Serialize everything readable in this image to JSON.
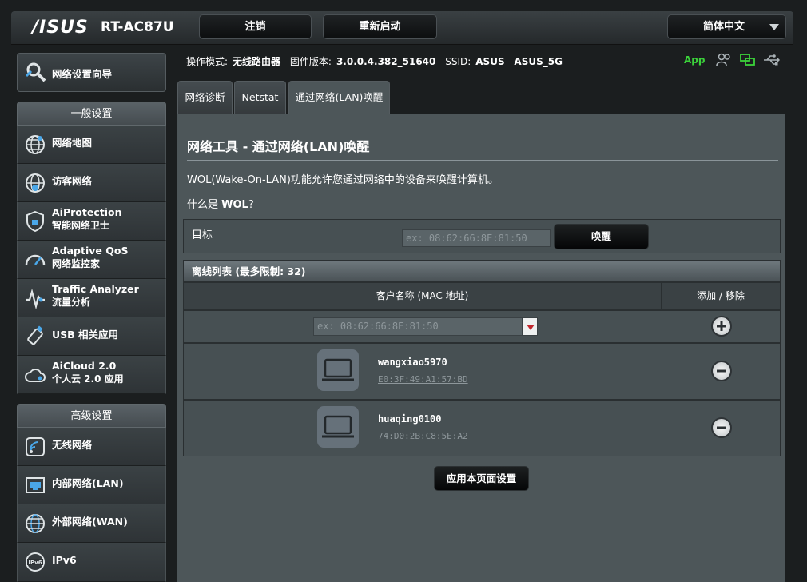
{
  "header": {
    "logo": "/ISUS",
    "model": "RT-AC87U",
    "logout_label": "注销",
    "reboot_label": "重新启动",
    "language": "简体中文"
  },
  "sidebar": {
    "wizard_label": "网络设置向导",
    "general_heading": "一般设置",
    "general_items": [
      {
        "label": "网络地图",
        "sub": ""
      },
      {
        "label": "访客网络",
        "sub": ""
      },
      {
        "label": "AiProtection",
        "sub": "智能网络卫士"
      },
      {
        "label": "Adaptive QoS",
        "sub": "网络监控家"
      },
      {
        "label": "Traffic Analyzer",
        "sub": "流量分析"
      },
      {
        "label": "USB 相关应用",
        "sub": ""
      },
      {
        "label": "AiCloud 2.0",
        "sub": "个人云 2.0 应用"
      }
    ],
    "advanced_heading": "高级设置",
    "advanced_items": [
      {
        "label": "无线网络"
      },
      {
        "label": "内部网络(LAN)"
      },
      {
        "label": "外部网络(WAN)"
      },
      {
        "label": "IPv6"
      }
    ]
  },
  "status": {
    "mode_label": "操作模式:",
    "mode_value": "无线路由器",
    "fw_label": "固件版本:",
    "fw_value": "3.0.0.4.382_51640",
    "ssid_label": "SSID:",
    "ssid1": "ASUS",
    "ssid2": "ASUS_5G",
    "app_label": "App"
  },
  "tabs": [
    {
      "label": "网络诊断"
    },
    {
      "label": "Netstat"
    },
    {
      "label": "通过网络(LAN)唤醒"
    }
  ],
  "main": {
    "title": "网络工具 - 通过网络(LAN)唤醒",
    "description": "WOL(Wake-On-LAN)功能允许您通过网络中的设备来唤醒计算机。",
    "whatis_prefix": "什么是 ",
    "whatis_link": "WOL",
    "whatis_suffix": "?",
    "target_label": "目标",
    "target_placeholder": "ex: 08:62:66:8E:81:50",
    "wake_label": "唤醒",
    "list_heading": "离线列表 (最多限制: 32)",
    "col_client": "客户名称 (MAC 地址)",
    "col_action": "添加 / 移除",
    "add_placeholder": "ex: 08:62:66:8E:81:50",
    "clients": [
      {
        "name": "wangxiao5970",
        "mac": "E0:3F:49:A1:57:BD"
      },
      {
        "name": "huaqing0100",
        "mac": "74:D0:2B:C8:5E:A2"
      }
    ],
    "apply_label": "应用本页面设置"
  }
}
